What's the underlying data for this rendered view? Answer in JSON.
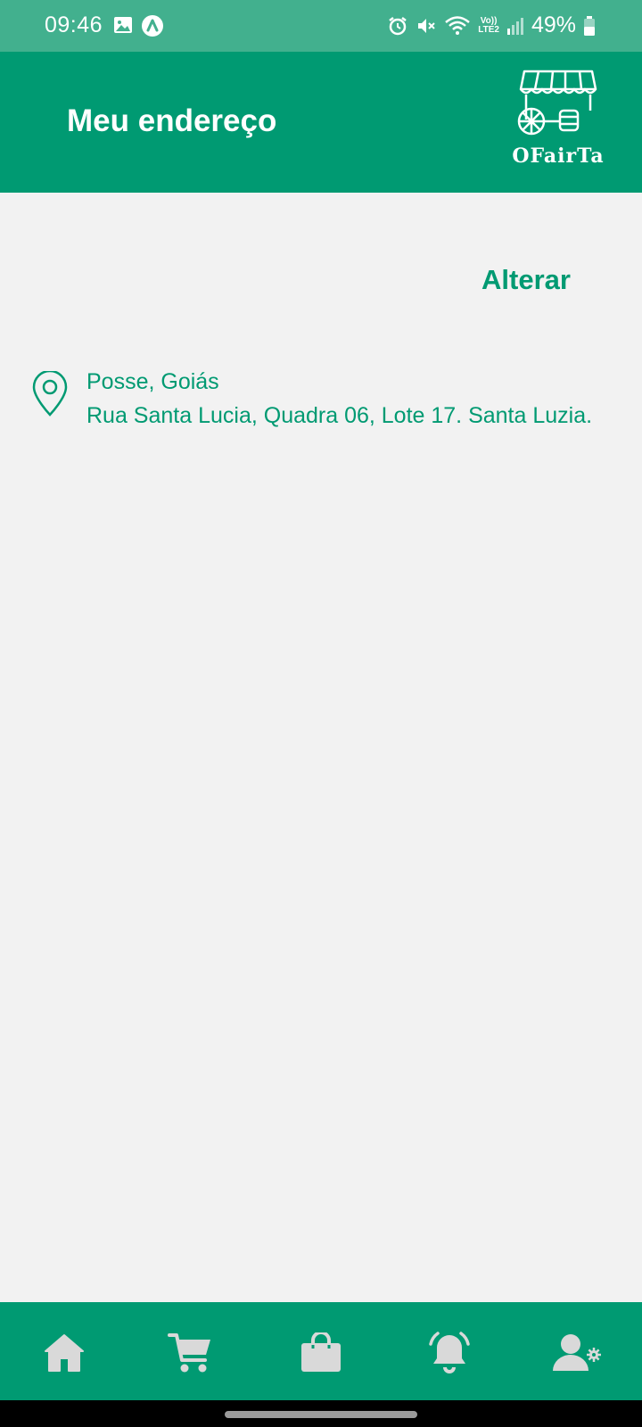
{
  "status_bar": {
    "time": "09:46",
    "battery": "49%",
    "network_label_top": "Vo))",
    "network_label_bottom": "LTE2",
    "icons": [
      "gallery-icon",
      "app-notification-icon",
      "alarm-icon",
      "mute-icon",
      "wifi-icon",
      "signal-icon",
      "battery-icon"
    ]
  },
  "header": {
    "title": "Meu endereço",
    "logo_text": "OFairTa"
  },
  "actions": {
    "change_label": "Alterar"
  },
  "address": {
    "city_state": "Posse, Goiás",
    "street": "Rua Santa Lucia, Quadra 06, Lote 17. Santa Luzia."
  },
  "bottom_nav": {
    "items": [
      "home-icon",
      "cart-icon",
      "shopping-bag-icon",
      "bell-icon",
      "user-settings-icon"
    ]
  },
  "colors": {
    "primary": "#009a72",
    "status_bar": "#42b08e",
    "background": "#f2f2f2",
    "nav_icon": "#d9d9d9"
  }
}
